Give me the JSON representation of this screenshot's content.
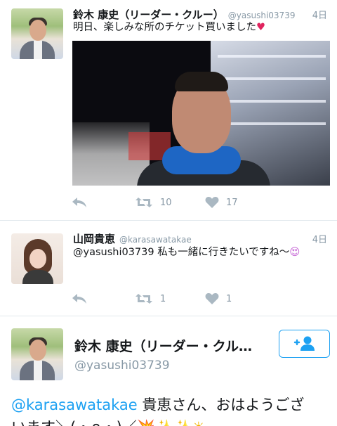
{
  "tweets": [
    {
      "name": "鈴木 康史（リーダー・クルー）",
      "handle": "@yasushi03739",
      "time": "4日",
      "text": "明日、楽しみな所のチケット買いました",
      "emoji": "♥",
      "has_media": true,
      "retweets": "10",
      "likes": "17"
    },
    {
      "name": "山岡貴恵",
      "handle": "@karasawatakae",
      "time": "4日",
      "text": "@yasushi03739 私も一緒に行きたいですね〜",
      "emoji": "😍",
      "retweets": "1",
      "likes": "1"
    }
  ],
  "profile_card": {
    "name": "鈴木 康史（リーダー・クル…",
    "handle": "@yasushi03739",
    "mention": "@karasawatakae",
    "text_line1": " 貴恵さん、おはようござ",
    "text_line2": "います＼(・∩・)／",
    "emoji_tail": "💥✨✨☀"
  },
  "icons": [
    "reply-icon",
    "retweet-icon",
    "like-icon",
    "follow-person-icon"
  ],
  "colors": {
    "accent": "#1da1f2",
    "muted": "#8899a6",
    "heart": "#e0245e"
  }
}
